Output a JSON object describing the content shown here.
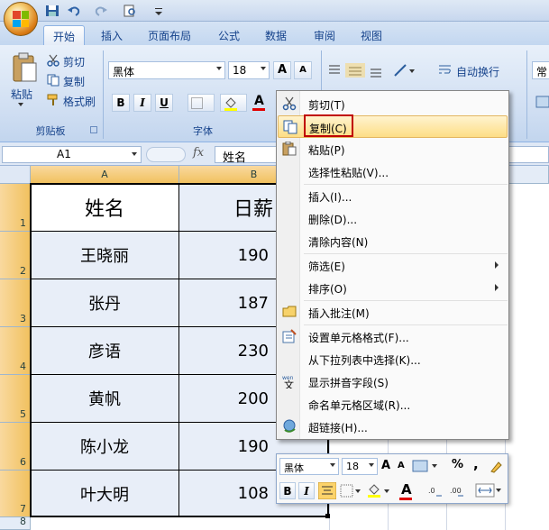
{
  "ribbon": {
    "tabs": [
      "开始",
      "插入",
      "页面布局",
      "公式",
      "数据",
      "审阅",
      "视图"
    ],
    "active_tab": "开始",
    "clipboard": {
      "group_label": "剪贴板",
      "paste_label": "粘贴",
      "cut_label": "剪切",
      "copy_label": "复制",
      "format_painter_label": "格式刷"
    },
    "font": {
      "group_label": "字体",
      "font_name": "黑体",
      "font_size": "18",
      "bold": "B",
      "italic": "I",
      "underline": "U",
      "grow": "A",
      "shrink": "A"
    },
    "alignment": {
      "wrap_text_label": "自动换行"
    },
    "number": {
      "format_partial": "常规"
    }
  },
  "formula_bar": {
    "name_box": "A1",
    "fx": "fx",
    "formula": "姓名"
  },
  "sheet": {
    "columns": [
      "A",
      "B"
    ],
    "rows": [
      "1",
      "2",
      "3",
      "4",
      "5",
      "6",
      "7",
      "8"
    ],
    "header": {
      "name": "姓名",
      "salary": "日薪"
    },
    "data": [
      {
        "name": "王晓丽",
        "salary": "190"
      },
      {
        "name": "张丹",
        "salary": "187"
      },
      {
        "name": "彦语",
        "salary": "230"
      },
      {
        "name": "黄帆",
        "salary": "200"
      },
      {
        "name": "陈小龙",
        "salary": "190"
      },
      {
        "name": "叶大明",
        "salary": "108"
      }
    ]
  },
  "context_menu": {
    "items": [
      {
        "label": "剪切(T)",
        "icon": "scissors-icon"
      },
      {
        "label": "复制(C)",
        "icon": "copy-icon",
        "highlighted": true
      },
      {
        "label": "粘贴(P)",
        "icon": "paste-icon"
      },
      {
        "label": "选择性粘贴(V)..."
      },
      {
        "label": "插入(I)..."
      },
      {
        "label": "删除(D)..."
      },
      {
        "label": "清除内容(N)"
      },
      {
        "label": "筛选(E)",
        "submenu": true
      },
      {
        "label": "排序(O)",
        "submenu": true
      },
      {
        "label": "插入批注(M)",
        "icon": "comment-icon"
      },
      {
        "label": "设置单元格格式(F)...",
        "icon": "format-cells-icon"
      },
      {
        "label": "从下拉列表中选择(K)..."
      },
      {
        "label": "显示拼音字段(S)",
        "icon": "phonetic-icon"
      },
      {
        "label": "命名单元格区域(R)..."
      },
      {
        "label": "超链接(H)...",
        "icon": "hyperlink-icon"
      }
    ]
  },
  "mini_toolbar": {
    "font_name": "黑体",
    "font_size": "18",
    "percent": "%",
    "comma": ",",
    "bold": "B",
    "italic": "I",
    "font_color_glyph": "A"
  },
  "colors": {
    "accent_orange": "#f1c15f",
    "highlight": "#fdde85",
    "red_box": "#c00000",
    "ribbon_blue": "#15428b"
  }
}
